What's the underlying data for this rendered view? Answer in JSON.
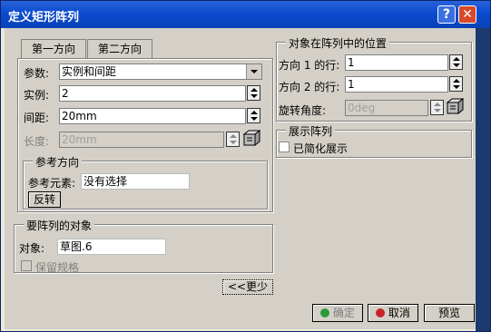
{
  "window": {
    "title": "定义矩形阵列"
  },
  "tabs": [
    {
      "label": "第一方向"
    },
    {
      "label": "第二方向"
    }
  ],
  "first_direction": {
    "param_label": "参数:",
    "param_value": "实例和间距",
    "instance_label": "实例:",
    "instance_value": "2",
    "spacing_label": "间距:",
    "spacing_value": "20mm",
    "length_label": "长度:",
    "length_value": "20mm"
  },
  "reference": {
    "group_label": "参考方向",
    "element_label": "参考元素:",
    "element_value": "没有选择",
    "reverse_button": "反转"
  },
  "object": {
    "group_label": "要阵列的对象",
    "label": "对象:",
    "value": "草图.6",
    "keep_spec_label": "保留规格"
  },
  "position": {
    "group_label": "对象在阵列中的位置",
    "row1_label": "方向 1 的行:",
    "row1_value": "1",
    "row2_label": "方向 2 的行:",
    "row2_value": "1",
    "angle_label": "旋转角度:",
    "angle_value": "0deg"
  },
  "display": {
    "group_label": "展示阵列",
    "simplified_label": "已简化展示"
  },
  "buttons": {
    "less": "<<更少",
    "ok": "确定",
    "cancel": "取消",
    "preview": "预览"
  }
}
